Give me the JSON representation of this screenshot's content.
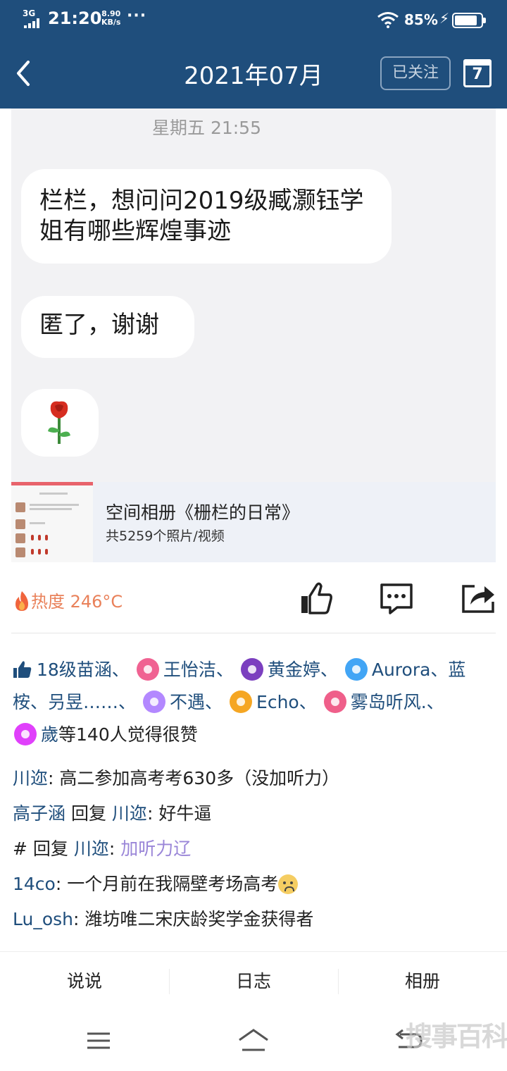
{
  "status_bar": {
    "network": "3G",
    "time": "21:20",
    "speed_value": "8.90",
    "speed_unit": "KB/s",
    "more": "···",
    "battery": "85%",
    "battery_level": 0.85
  },
  "nav": {
    "title": "2021年07月",
    "follow_label": "已关注",
    "calendar_day": "7"
  },
  "chat": {
    "timestamp": "星期五 21:55",
    "messages": [
      "栏栏，想问问2019级臧灏钰学姐有哪些辉煌事迹",
      "匿了，谢谢"
    ]
  },
  "album": {
    "title": "空间相册《栅栏的日常》",
    "count": "共5259个照片/视频"
  },
  "heat": {
    "label": "热度 246°C"
  },
  "likes": {
    "names": [
      "18级苗涵、",
      "王怡洁、",
      "黄金婷、",
      "Aurora、蓝桉、",
      "叧昱……、",
      "不遇、",
      "Echo、",
      "雾岛听风.、",
      "歲"
    ],
    "suffix": "等140人觉得很赞",
    "colors": [
      "#f06292",
      "#7b3fbf",
      "#42a5f5",
      "#b388ff",
      "#f5a623",
      "#ef5f8a",
      "#e040fb"
    ]
  },
  "comments": [
    {
      "author": "川迩",
      "sep": ": ",
      "text": "高二参加高考考630多（没加听力）"
    },
    {
      "author": "高子涵",
      "reply_word": " 回复 ",
      "target": "川迩",
      "sep": ": ",
      "text": "好牛逼"
    },
    {
      "author": "#",
      "reply_word": " 回复 ",
      "target": "川迩",
      "sep": ": ",
      "text": "加听力辽"
    },
    {
      "author": "14co",
      "sep": ": ",
      "text": "一个月前在我隔壁考场高考"
    },
    {
      "author": "Lu_osh",
      "sep": ": ",
      "text": "潍坊唯二宋庆龄奖学金获得者"
    }
  ],
  "tabs": [
    "说说",
    "日志",
    "相册"
  ],
  "watermark": "搜事百科"
}
